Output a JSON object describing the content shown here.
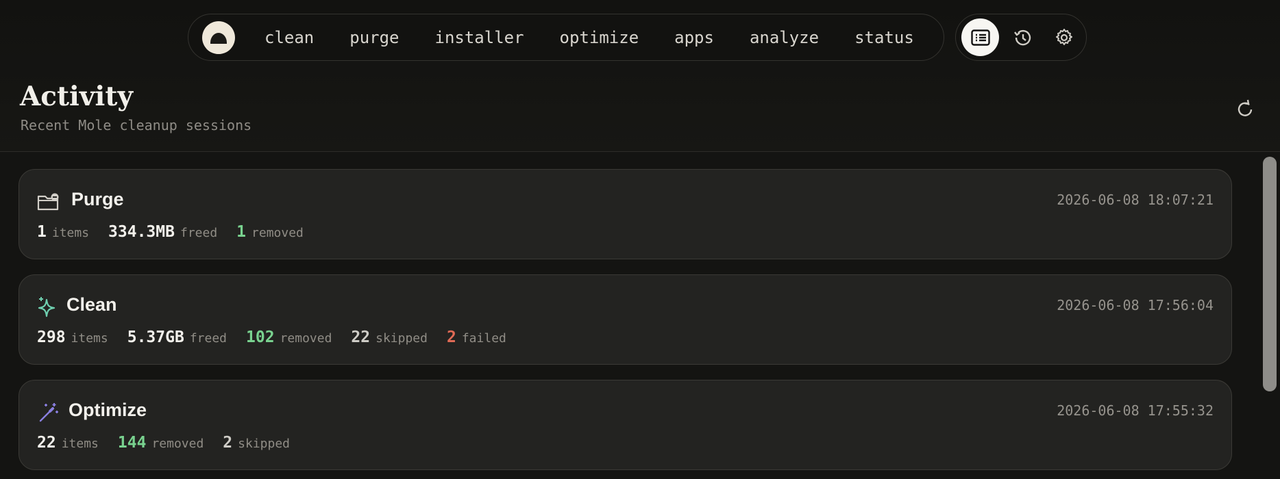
{
  "nav": {
    "logo": "mole-logo",
    "items": [
      "clean",
      "purge",
      "installer",
      "optimize",
      "apps",
      "analyze",
      "status"
    ]
  },
  "tools": [
    "activity-list-icon",
    "history-icon",
    "settings-gear-icon"
  ],
  "header": {
    "title": "Activity",
    "subtitle": "Recent Mole cleanup sessions"
  },
  "sessions": [
    {
      "name": "Purge",
      "icon": "folder-minus-icon",
      "timestamp": "2026-06-08 18:07:21",
      "stats": [
        {
          "value": "1",
          "label": "items"
        },
        {
          "value": "334.3MB",
          "label": "freed"
        },
        {
          "value": "1",
          "label": "removed"
        }
      ]
    },
    {
      "name": "Clean",
      "icon": "sparkles-icon",
      "timestamp": "2026-06-08 17:56:04",
      "stats": [
        {
          "value": "298",
          "label": "items"
        },
        {
          "value": "5.37GB",
          "label": "freed"
        },
        {
          "value": "102",
          "label": "removed"
        },
        {
          "value": "22",
          "label": "skipped"
        },
        {
          "value": "2",
          "label": "failed"
        }
      ]
    },
    {
      "name": "Optimize",
      "icon": "magic-wand-icon",
      "timestamp": "2026-06-08 17:55:32",
      "stats": [
        {
          "value": "22",
          "label": "items"
        },
        {
          "value": "144",
          "label": "removed"
        },
        {
          "value": "2",
          "label": "skipped"
        }
      ]
    }
  ],
  "colors": {
    "background": "#141412",
    "card": "#232321",
    "removed": "#79d28f",
    "failed": "#e06a55",
    "accent_clean": "#6fd0b0",
    "accent_optimize": "#8a7fe0"
  }
}
